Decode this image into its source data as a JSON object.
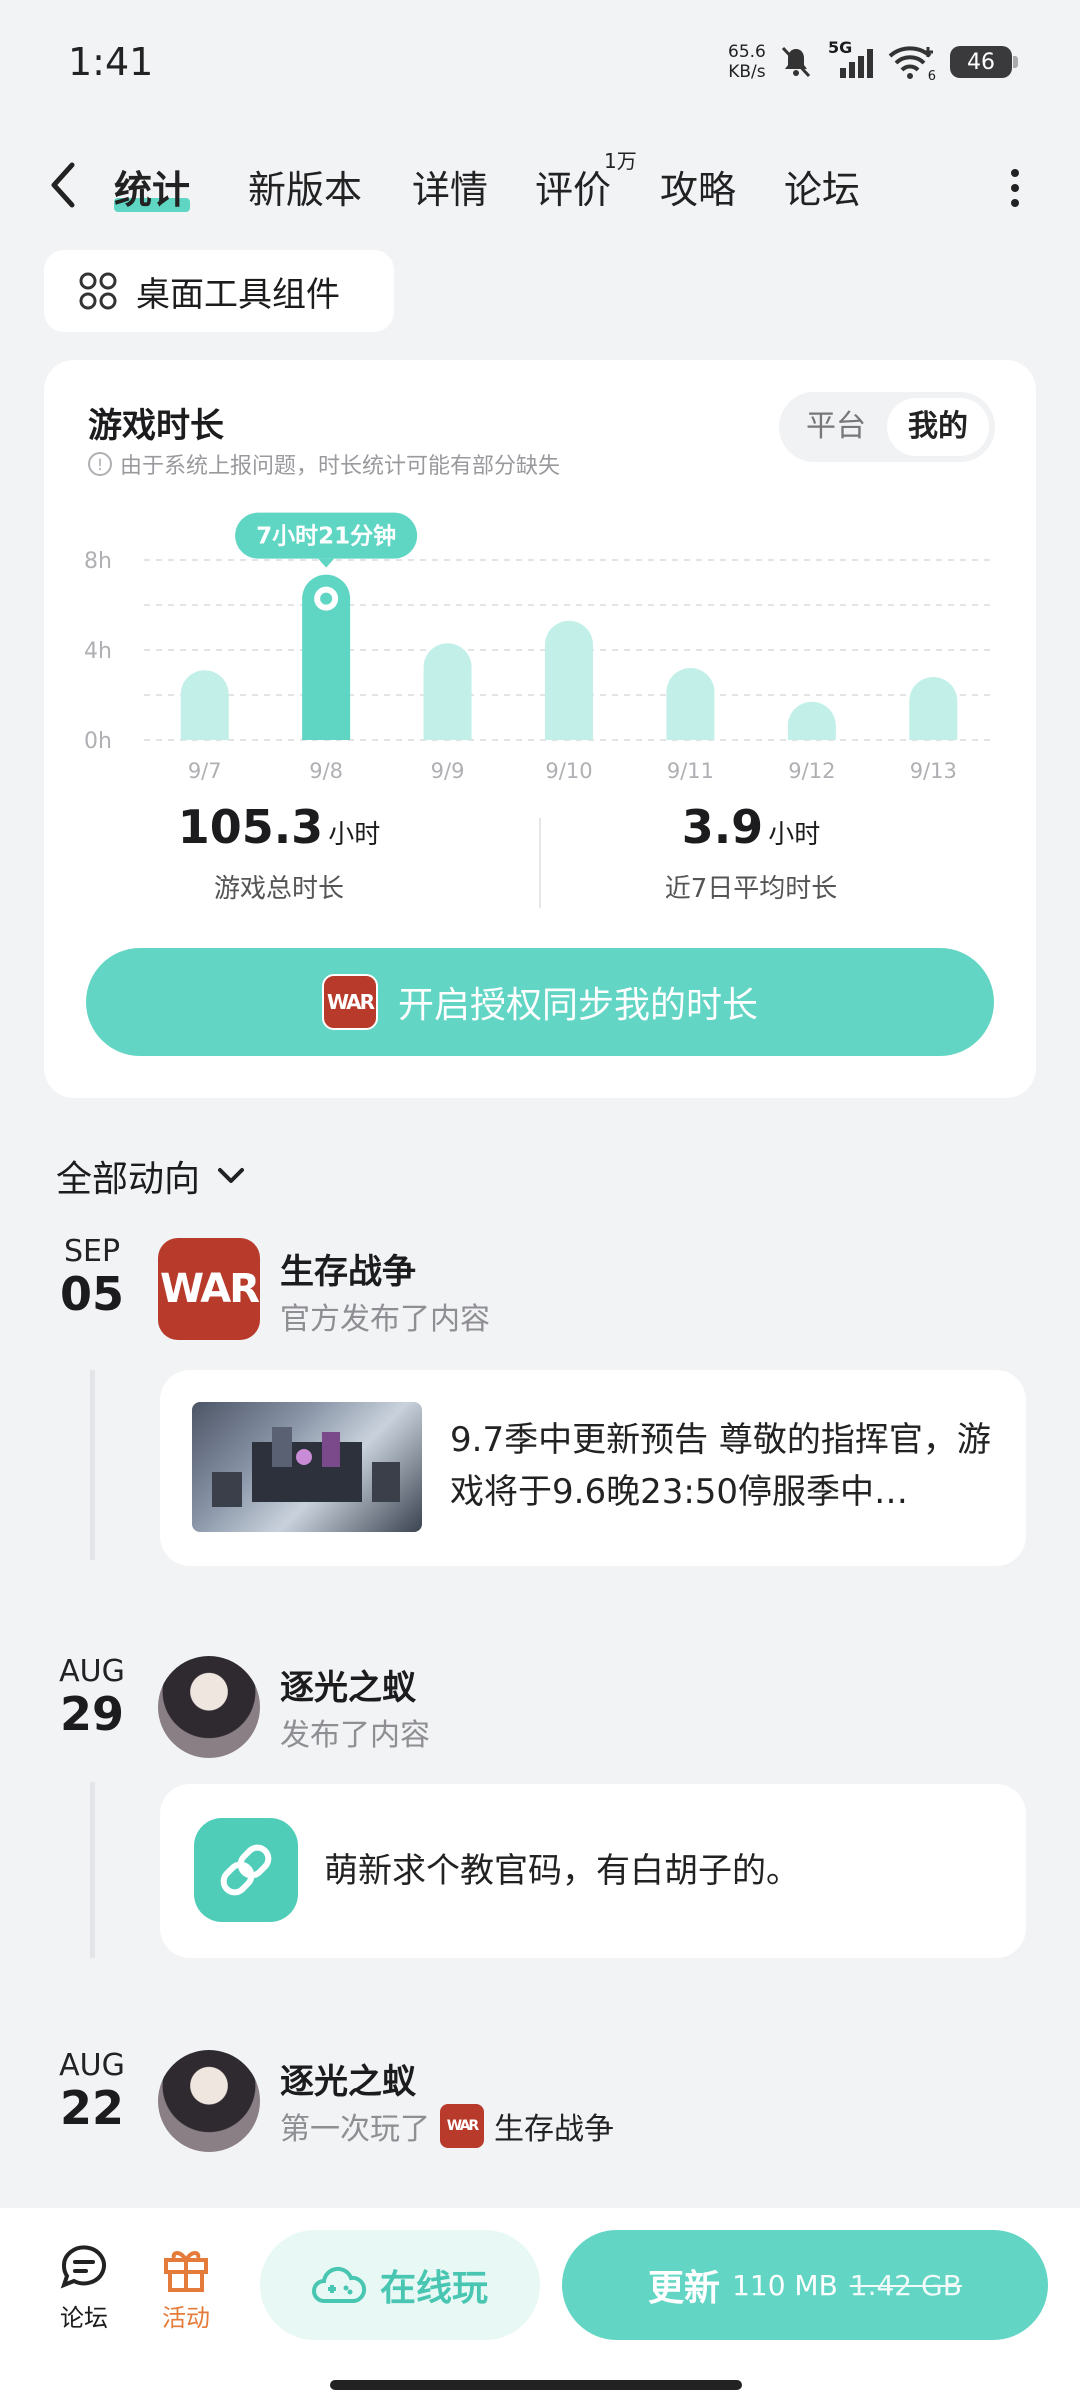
{
  "status": {
    "time": "1:41",
    "net_speed": "65.6",
    "net_unit": "KB/s",
    "signal_label": "5G",
    "wifi_sub": "6",
    "battery": "46"
  },
  "tabs": [
    {
      "label": "统计",
      "active": true
    },
    {
      "label": "新版本"
    },
    {
      "label": "详情"
    },
    {
      "label": "评价",
      "badge": "1万"
    },
    {
      "label": "攻略"
    },
    {
      "label": "论坛"
    }
  ],
  "widget_button": "桌面工具组件",
  "stats_card": {
    "title": "游戏时长",
    "note": "由于系统上报问题，时长统计可能有部分缺失",
    "segment": [
      "平台",
      "我的"
    ],
    "total_value": "105.3",
    "total_unit": "小时",
    "total_label": "游戏总时长",
    "avg_value": "3.9",
    "avg_unit": "小时",
    "avg_label": "近7日平均时长",
    "sync_button": "开启授权同步我的时长",
    "logo_text": "WAR"
  },
  "chart_data": {
    "type": "bar",
    "categories": [
      "9/7",
      "9/8",
      "9/9",
      "9/10",
      "9/11",
      "9/12",
      "9/13"
    ],
    "values": [
      3.1,
      7.35,
      4.3,
      5.3,
      3.2,
      1.7,
      2.8
    ],
    "y_ticks": [
      "8h",
      "4h",
      "0h"
    ],
    "ylim": [
      0,
      8
    ],
    "highlight_index": 1,
    "highlight_label": "7小时21分钟",
    "bar_color": "#c2f0e9",
    "highlight_color": "#5fd6c3"
  },
  "feed": {
    "filter_label": "全部动向",
    "items": [
      {
        "month": "SEP",
        "day": "05",
        "name": "生存战争",
        "sub": "官方发布了内容",
        "post": "9.7季中更新预告 尊敬的指挥官，游戏将于9.6晚23:50停服季中…"
      },
      {
        "month": "AUG",
        "day": "29",
        "name": "逐光之蚁",
        "sub": "发布了内容",
        "post": "萌新求个教官码，有白胡子的。"
      },
      {
        "month": "AUG",
        "day": "22",
        "name": "逐光之蚁",
        "sub": "第一次玩了",
        "sub_game": "生存战争"
      }
    ]
  },
  "bottom_bar": {
    "forum": "论坛",
    "activity": "活动",
    "play_online": "在线玩",
    "update": "更新",
    "update_size": "110 MB",
    "full_size": "1.42 GB"
  }
}
